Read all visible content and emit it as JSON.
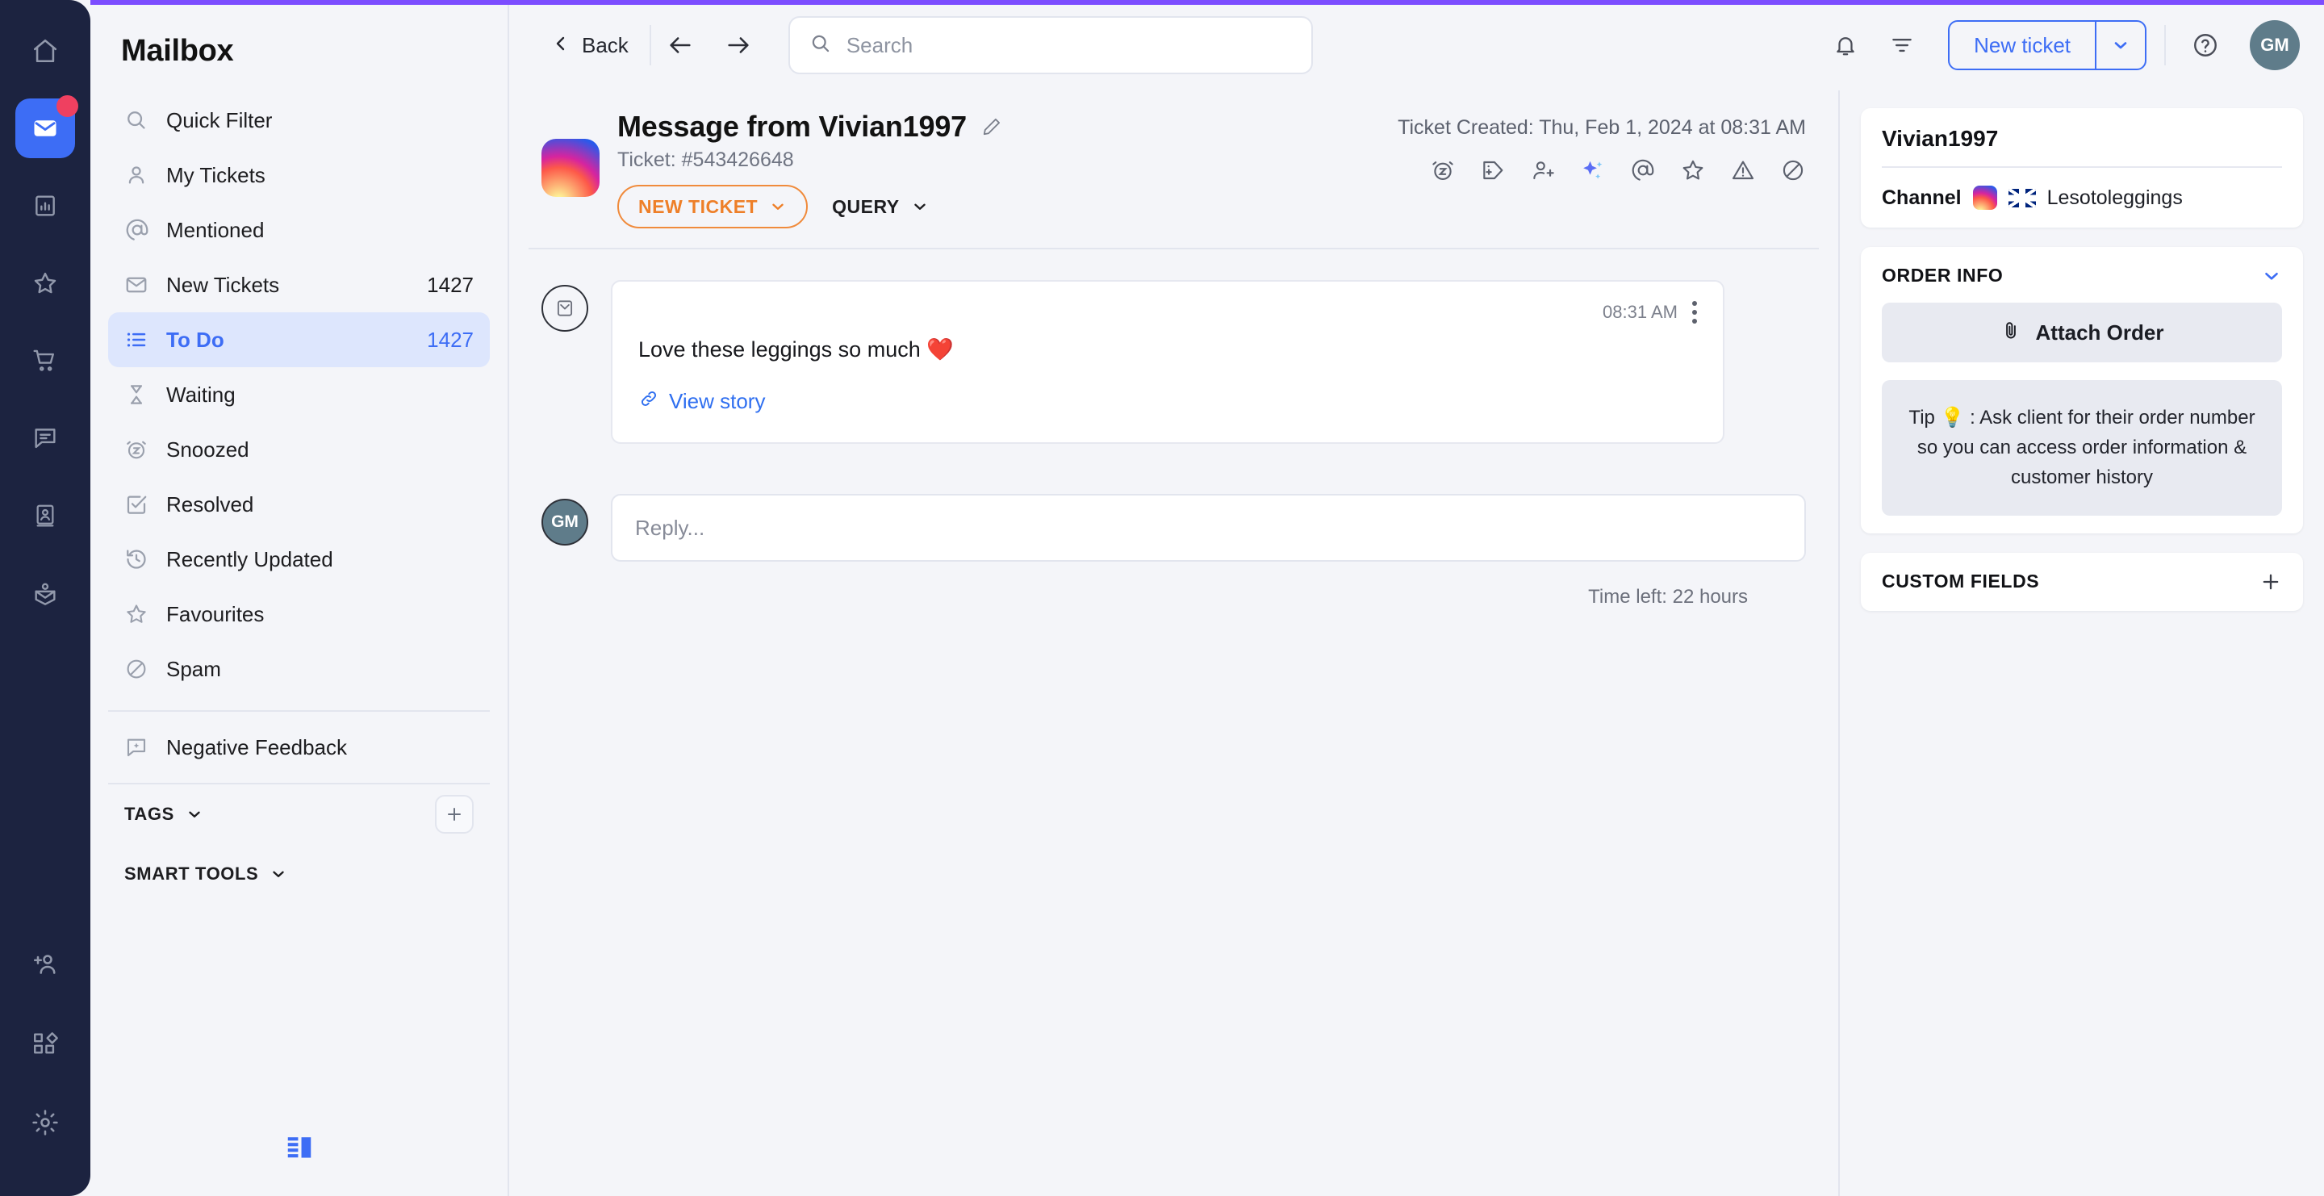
{
  "accent_colors": {
    "top_accent": "#7c4dff",
    "primary_blue": "#3d6df5",
    "selected_bg": "#dde6fd",
    "badge_orange": "#ee7f28",
    "rail_dark": "#1c2340",
    "notification_red": "#ef4060"
  },
  "rail": {
    "items": [
      {
        "icon": "home-icon",
        "active": false
      },
      {
        "icon": "mail-icon",
        "active": true,
        "badge": true
      },
      {
        "icon": "reports-icon",
        "active": false
      },
      {
        "icon": "star-icon",
        "active": false
      },
      {
        "icon": "cart-icon",
        "active": false
      },
      {
        "icon": "chat-icon",
        "active": false
      },
      {
        "icon": "contacts-icon",
        "active": false
      },
      {
        "icon": "knowledge-icon",
        "active": false
      }
    ],
    "bottom_items": [
      {
        "icon": "add-user-icon"
      },
      {
        "icon": "apps-icon"
      },
      {
        "icon": "settings-gear-icon"
      }
    ]
  },
  "sidebar": {
    "title": "Mailbox",
    "items": [
      {
        "label": "Quick Filter",
        "count": "",
        "icon": "search-icon",
        "selected": false
      },
      {
        "label": "My Tickets",
        "count": "",
        "icon": "user-icon",
        "selected": false
      },
      {
        "label": "Mentioned",
        "count": "",
        "icon": "at-icon",
        "selected": false
      },
      {
        "label": "New Tickets",
        "count": "1427",
        "icon": "envelope-icon",
        "selected": false
      },
      {
        "label": "To Do",
        "count": "1427",
        "icon": "list-icon",
        "selected": true
      },
      {
        "label": "Waiting",
        "count": "",
        "icon": "hourglass-icon",
        "selected": false
      },
      {
        "label": "Snoozed",
        "count": "",
        "icon": "snooze-icon",
        "selected": false
      },
      {
        "label": "Resolved",
        "count": "",
        "icon": "check-square-icon",
        "selected": false
      },
      {
        "label": "Recently Updated",
        "count": "",
        "icon": "history-icon",
        "selected": false
      },
      {
        "label": "Favourites",
        "count": "",
        "icon": "star-outline-icon",
        "selected": false
      },
      {
        "label": "Spam",
        "count": "",
        "icon": "ban-icon",
        "selected": false
      }
    ],
    "negative_feedback": {
      "label": "Negative Feedback",
      "icon": "feedback-icon"
    },
    "tags_section": {
      "label": "TAGS",
      "add_tooltip": "+"
    },
    "smart_tools_section": {
      "label": "SMART TOOLS"
    },
    "collapse_toggle": "collapse-panel-icon"
  },
  "topbar": {
    "back_label": "Back",
    "back_icon": "chevron-left-icon",
    "prev_icon": "arrow-left-icon",
    "next_icon": "arrow-right-icon",
    "search": {
      "placeholder": "Search",
      "value": "",
      "icon": "search-icon"
    },
    "bell_icon": "bell-icon",
    "filter_icon": "filter-icon",
    "new_ticket_label": "New ticket",
    "new_ticket_caret": "chevron-down-icon",
    "help_icon": "help-circle-icon",
    "avatar_initials": "GM"
  },
  "ticket": {
    "channel_icon": "instagram-icon",
    "title": "Message from Vivian1997",
    "edit_icon": "pencil-icon",
    "subtitle": "Ticket: #543426648",
    "status_badge": "NEW TICKET",
    "status_caret": "chevron-down-icon",
    "type_dropdown": "QUERY",
    "type_caret": "chevron-down-icon",
    "created": "Ticket Created: Thu, Feb 1, 2024 at 08:31 AM",
    "actions": [
      {
        "icon": "snooze-icon"
      },
      {
        "icon": "tag-add-icon"
      },
      {
        "icon": "assign-user-icon"
      },
      {
        "icon": "ai-sparkle-icon"
      },
      {
        "icon": "at-mention-icon"
      },
      {
        "icon": "star-icon"
      },
      {
        "icon": "warning-icon"
      },
      {
        "icon": "block-icon"
      }
    ]
  },
  "message": {
    "channel_icon": "instagram-message-icon",
    "time": "08:31 AM",
    "menu_icon": "kebab-menu-icon",
    "text": "Love these leggings so much ❤️",
    "link_label": "View story",
    "link_icon": "link-icon"
  },
  "reply": {
    "avatar_initials": "GM",
    "placeholder": "Reply...",
    "value": "",
    "time_left": "Time left: 22 hours"
  },
  "right_panel": {
    "customer_name": "Vivian1997",
    "channel_label": "Channel",
    "channel_icon": "instagram-icon",
    "channel_flag": "uk-flag-icon",
    "channel_value": "Lesotoleggings",
    "order_info": {
      "title": "ORDER INFO",
      "collapse_icon": "chevron-down-icon",
      "attach_label": "Attach Order",
      "attach_icon": "paperclip-icon",
      "tip": "Tip 💡 : Ask client for their order number so you can access order information & customer history"
    },
    "custom_fields": {
      "title": "CUSTOM FIELDS",
      "add_icon": "plus-icon"
    }
  }
}
